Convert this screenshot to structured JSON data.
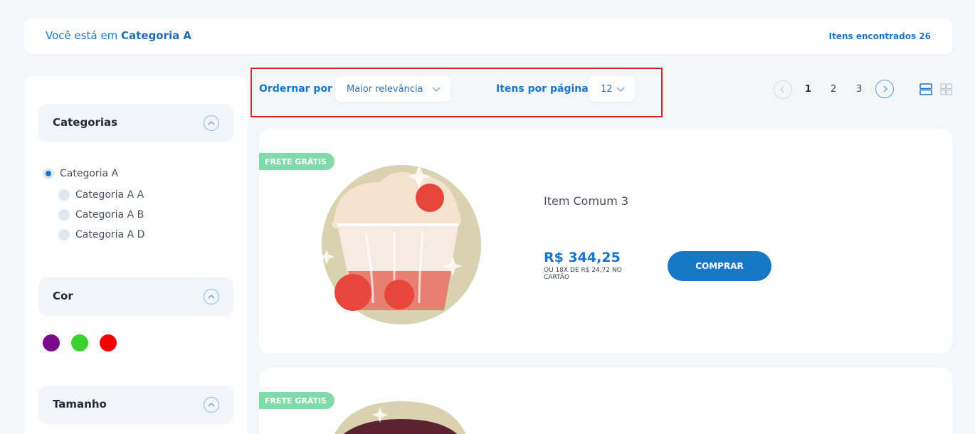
{
  "breadcrumb": {
    "prefix": "Você está em",
    "current": "Categoria A"
  },
  "results": {
    "label": "Itens encontrados 26"
  },
  "filters": {
    "categories": {
      "title": "Categorias",
      "items": [
        {
          "label": "Categoria A",
          "selected": true
        },
        {
          "label": "Categoria A A",
          "selected": false
        },
        {
          "label": "Categoria A B",
          "selected": false
        },
        {
          "label": "Categoria A D",
          "selected": false
        }
      ]
    },
    "color": {
      "title": "Cor",
      "swatches": [
        "#7b0a8a",
        "#3bd12f",
        "#f20000"
      ]
    },
    "size": {
      "title": "Tamanho"
    }
  },
  "toolbar": {
    "sort_label": "Ordernar por",
    "sort_value": "Maior relevância",
    "per_page_label": "Itens por página",
    "per_page_value": "12"
  },
  "pagination": {
    "pages": [
      "1",
      "2",
      "3"
    ],
    "current": "1"
  },
  "products": [
    {
      "badge": "FRETE GRÁTIS",
      "name": "Item Comum 3",
      "price": "R$ 344,25",
      "installments": "OU 18X DE R$ 24,72 NO CARTÃO",
      "buy_label": "COMPRAR"
    },
    {
      "badge": "FRETE GRÁTIS"
    }
  ],
  "colors": {
    "accent": "#1976c8",
    "badge": "#7fdcaa",
    "highlight": "#e41e26"
  }
}
